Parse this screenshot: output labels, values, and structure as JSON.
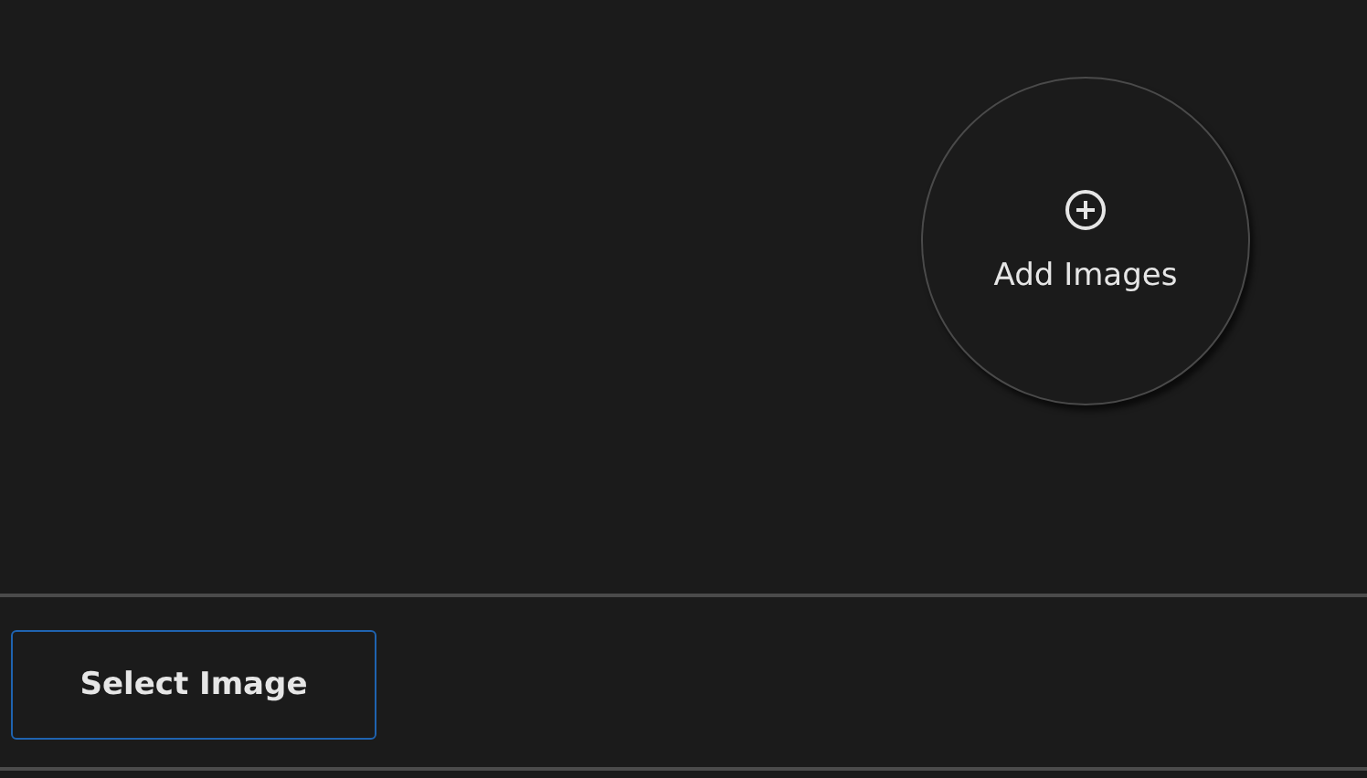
{
  "add_images": {
    "label": "Add Images"
  },
  "footer": {
    "button": {
      "label": "Select Image"
    }
  }
}
